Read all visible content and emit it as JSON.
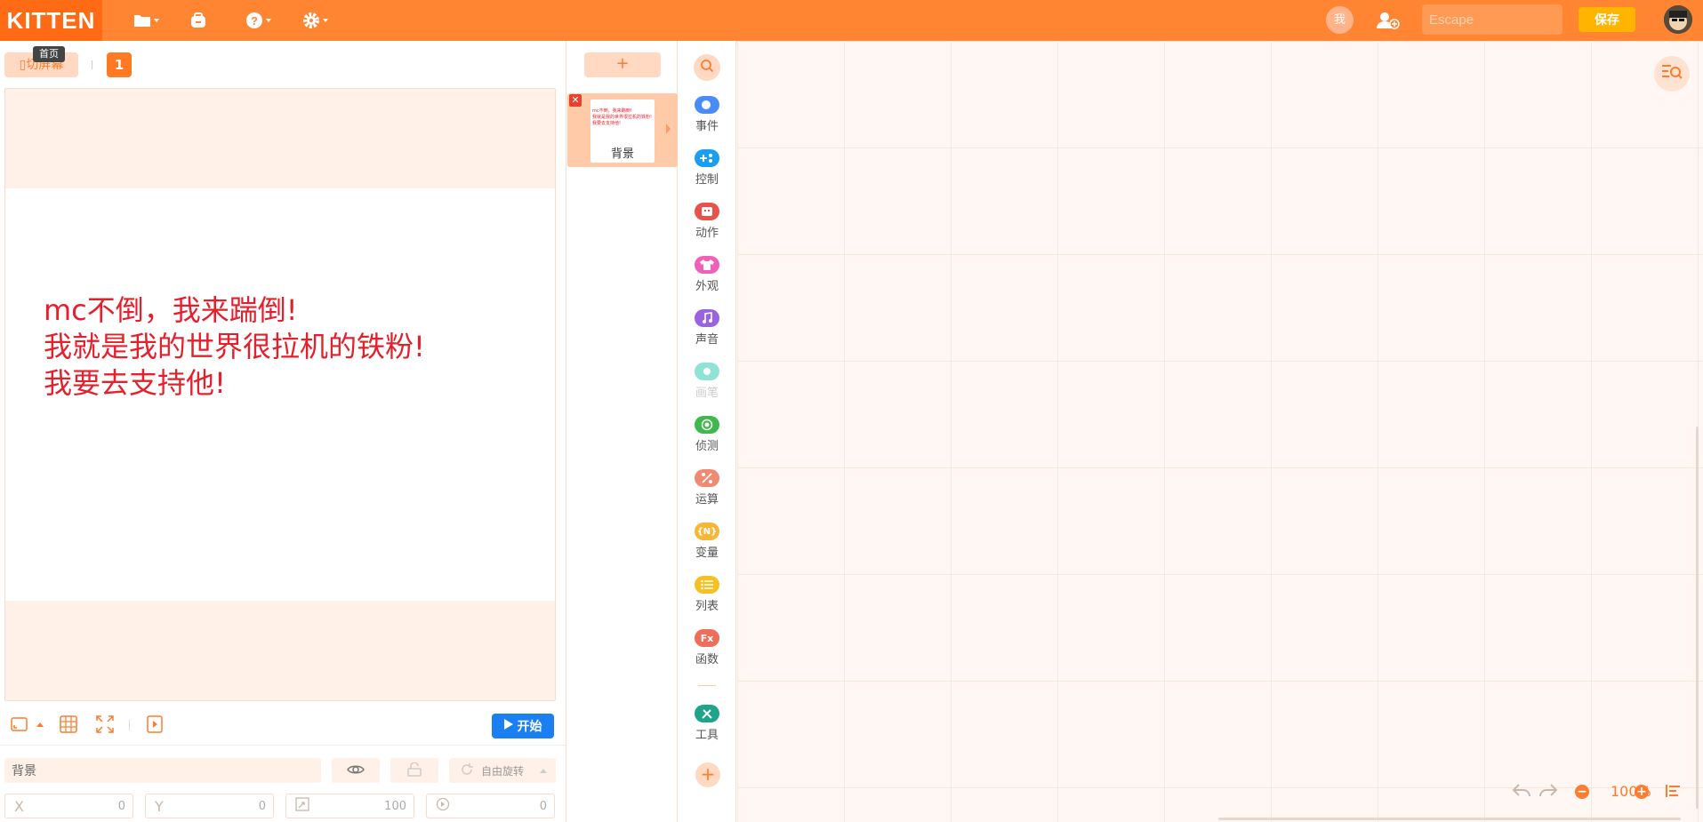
{
  "app": {
    "logo": "KITTEN",
    "tooltip": "首页",
    "me_label": "我",
    "search_placeholder": "Escape",
    "save_label": "保存"
  },
  "stage": {
    "screen_button": "切屏幕",
    "screen_number": "1",
    "lines": [
      "mc不倒，我来踹倒!",
      "我就是我的世界很拉机的铁粉!",
      "我要去支持他!"
    ],
    "start_label": "开始",
    "text_color": "#e4202c"
  },
  "sprite": {
    "name": "背景",
    "rotation_label": "自由旋转",
    "x_label": "X",
    "x_value": "0",
    "y_label": "Y",
    "y_value": "0",
    "size_value": "100",
    "direction_value": "0"
  },
  "scenes": {
    "add_label": "+",
    "items": [
      {
        "label": "背景"
      }
    ]
  },
  "categories": [
    {
      "name": "事件",
      "color": "#4a8cf7",
      "icon": "toggle-icon"
    },
    {
      "name": "控制",
      "color": "#1b9ef0",
      "icon": "control-icon"
    },
    {
      "name": "动作",
      "color": "#e8524a",
      "icon": "robot-icon"
    },
    {
      "name": "外观",
      "color": "#f05fb8",
      "icon": "shirt-icon"
    },
    {
      "name": "声音",
      "color": "#9a64e0",
      "icon": "music-icon"
    },
    {
      "name": "画笔",
      "color": "#8fe3d6",
      "icon": "brush-icon"
    },
    {
      "name": "侦测",
      "color": "#3fb84d",
      "icon": "target-icon"
    },
    {
      "name": "运算",
      "color": "#f08a72",
      "icon": "percent-icon"
    },
    {
      "name": "变量",
      "color": "#f7b736",
      "icon": "variable-icon"
    },
    {
      "name": "列表",
      "color": "#f6c022",
      "icon": "list-icon"
    },
    {
      "name": "函数",
      "color": "#f06d5a",
      "icon": "function-icon"
    },
    {
      "name": "工具",
      "color": "#1fa48a",
      "icon": "tools-icon"
    }
  ],
  "category_symbols": {
    "variable": "{N}",
    "function": "Fx"
  },
  "workspace": {
    "zoom": "100%",
    "zoom_out": "−",
    "zoom_in": "+"
  },
  "colors": {
    "topbar": "#ff8533",
    "accent": "#ff7c2e",
    "start": "#1a7ff0",
    "save": "#ffb400"
  }
}
